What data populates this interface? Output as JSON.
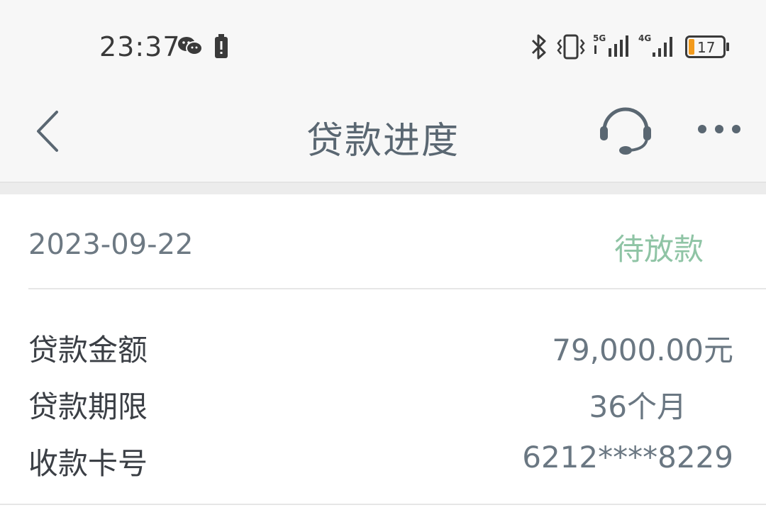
{
  "status_bar": {
    "time": "23:37",
    "network_5g": "5G",
    "network_4g": "4G",
    "battery": "17",
    "icons": [
      "wechat-icon",
      "battery-saver-icon",
      "bluetooth-icon",
      "vibrate-icon",
      "signal-5g-icon",
      "signal-4g-icon",
      "battery-icon"
    ]
  },
  "nav": {
    "title": "贷款进度",
    "back_icon": "back-arrow-icon",
    "support_icon": "headset-icon",
    "more_icon": "more-icon"
  },
  "loan": {
    "date": "2023-09-22",
    "status": "待放款",
    "rows": [
      {
        "label": "贷款金额",
        "value": "79,000.00元"
      },
      {
        "label": "贷款期限",
        "value": "36个月"
      },
      {
        "label": "收款卡号",
        "value": "6212****8229"
      }
    ]
  },
  "colors": {
    "status_green": "#8fc4a5",
    "title_gray": "#5a6772",
    "battery_orange": "#f29a1c"
  }
}
